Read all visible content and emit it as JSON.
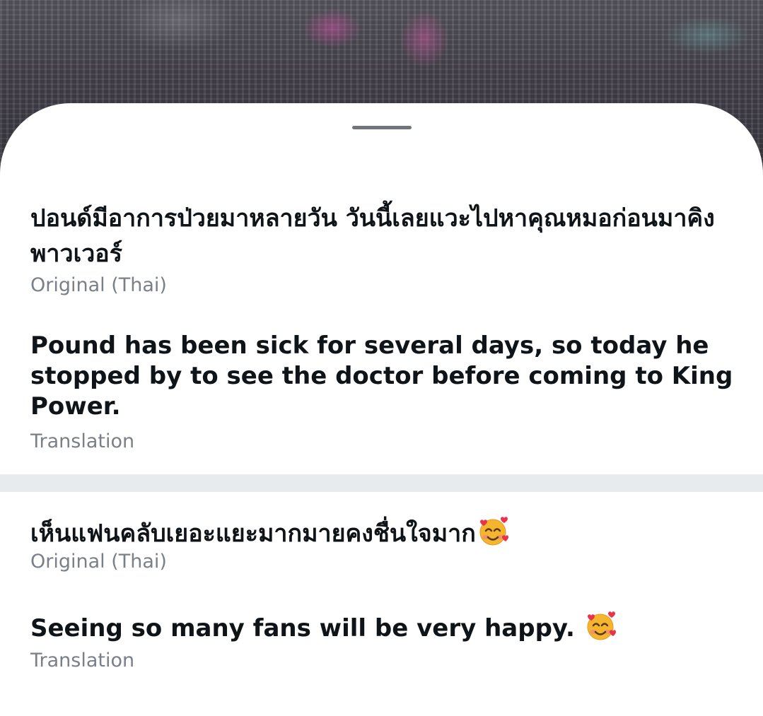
{
  "sheet": {
    "entries": [
      {
        "original": "ปอนด์มีอาการป่วยมาหลายวัน  วันนี้เลยแวะไปหาคุณหมอก่อนมาคิงพาวเวอร์",
        "original_label": "Original (Thai)",
        "translation": "Pound has been sick for several days, so today he stopped by to see the doctor before coming to King Power.",
        "translation_label": "Translation"
      },
      {
        "original": "เห็นแฟนคลับเยอะแยะมากมายคงชื่นใจมาก",
        "original_emoji": "smiling-face-with-hearts-emoji",
        "original_label": "Original (Thai)",
        "translation": "Seeing so many fans will be very happy.",
        "translation_emoji": "smiling-face-with-hearts-emoji",
        "translation_label": "Translation"
      }
    ]
  }
}
